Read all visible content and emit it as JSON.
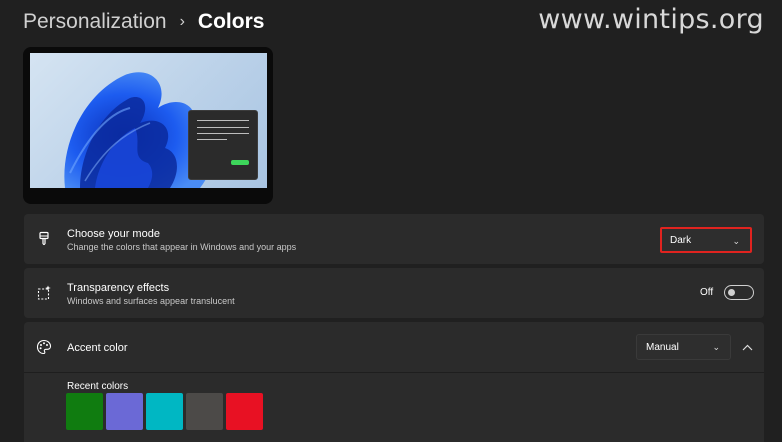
{
  "breadcrumb": {
    "parent": "Personalization",
    "separator": "›",
    "current": "Colors"
  },
  "watermark": "www.wintips.org",
  "mode": {
    "title": "Choose your mode",
    "description": "Change the colors that appear in Windows and your apps",
    "selected": "Dark",
    "icon": "paintbrush-icon"
  },
  "transparency": {
    "title": "Transparency effects",
    "description": "Windows and surfaces appear translucent",
    "state_label": "Off",
    "enabled": false,
    "icon": "transparency-icon"
  },
  "accent": {
    "title": "Accent color",
    "selected": "Manual",
    "icon": "palette-icon",
    "expanded": true,
    "recent_label": "Recent colors",
    "recent_colors": [
      "#107c10",
      "#6b69d6",
      "#00b7c3",
      "#4c4a48",
      "#e81123"
    ]
  },
  "colors": {
    "highlight_border": "#e0231f",
    "preview_accent": "#3dd65b"
  }
}
